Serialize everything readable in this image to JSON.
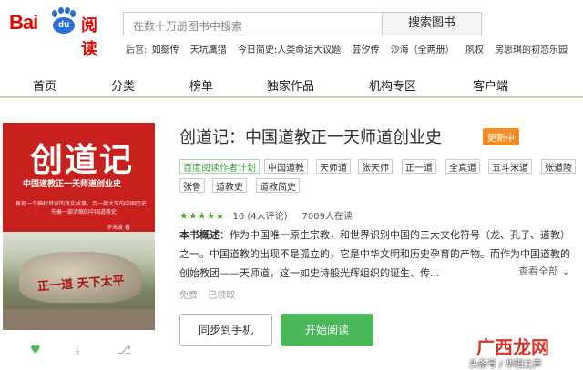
{
  "header": {
    "logo_text": "Bai",
    "logo_du": "du",
    "logo_reading": "阅读",
    "search_placeholder": "在数十万册图书中搜索",
    "search_button": "搜索图书",
    "hot_label": "后宫:",
    "hot_items": [
      "如懿传",
      "天坑鹰猎",
      "今日简史:人类命运大议题",
      "芸汐传",
      "沙海（全两册）",
      "夙权",
      "房思琪的初恋乐园"
    ]
  },
  "nav": {
    "items": [
      "首页",
      "分类",
      "榜单",
      "独家作品",
      "机构专区",
      "客户端"
    ]
  },
  "cover": {
    "title": "创道记",
    "subtitle": "中国道教正一天师道创业史",
    "blurb": "再现一个神权世家的真实故事，另一部大写的中国历史，先秦一部浓缩的中国道教史",
    "author": "李海波 著",
    "stone_text": "正一道 天下太平"
  },
  "book": {
    "title": "创道记：中国道教正一天师道创业史",
    "badge": "更新中",
    "tags": [
      "百度阅读作者计划",
      "中国道教",
      "天师道",
      "张天师",
      "正一道",
      "全真道",
      "五斗米道",
      "张道陵",
      "张鲁",
      "道教史",
      "道教简史"
    ],
    "stars": "★★★★★",
    "rating": "10 (4人评论)",
    "readers": "7009人在读",
    "desc_label": "本书概述",
    "desc_text": "：作为中国唯一原生宗教，和世界识别中国的三大文化符号（龙、孔子、道教）之一。中国道教的出现不是孤立的，它是中华文明和历史孕育的产物。而作为中国道教的创始教团——天师道，这一如史诗般光辉组织的诞生、传...",
    "more": "查看全部",
    "price": "免费",
    "status": "已领取",
    "sync_button": "同步到手机",
    "read_button": "开始阅读"
  },
  "actions": {
    "like_icon": "heart-icon",
    "download_icon": "download-icon",
    "share_icon": "share-icon"
  },
  "watermark": {
    "big": "广西龙网",
    "small": "头条号 / 华阳之声"
  },
  "colors": {
    "brand_red": "#e10602",
    "accent_green": "#49b85a",
    "badge_orange": "#f78b1e",
    "cover_red": "#c8201c"
  }
}
